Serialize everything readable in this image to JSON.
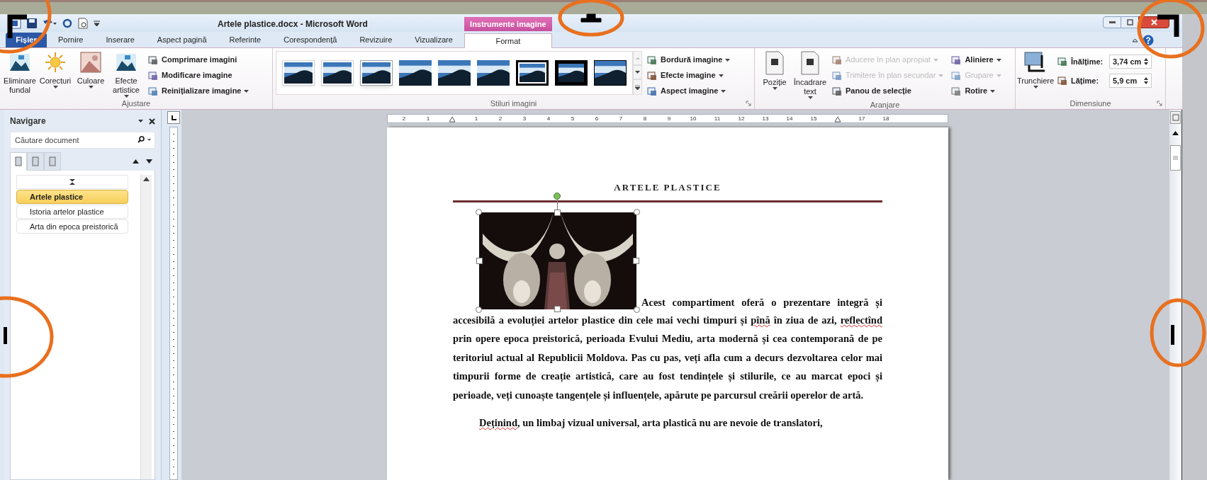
{
  "window": {
    "title": "Artele plastice.docx - Microsoft Word",
    "contextual_label": "Instrumente imagine"
  },
  "tabs": [
    {
      "label": "Fișier",
      "kind": "file",
      "selected": false
    },
    {
      "label": "Pornire",
      "kind": "tab",
      "selected": false
    },
    {
      "label": "Inserare",
      "kind": "tab",
      "selected": false
    },
    {
      "label": "Aspect pagină",
      "kind": "tab",
      "selected": false
    },
    {
      "label": "Referinte",
      "kind": "tab",
      "selected": false
    },
    {
      "label": "Corespondență",
      "kind": "tab",
      "selected": false
    },
    {
      "label": "Revizuire",
      "kind": "tab",
      "selected": false
    },
    {
      "label": "Vizualizare",
      "kind": "tab",
      "selected": false
    },
    {
      "label": "Format",
      "kind": "contextual",
      "selected": true
    }
  ],
  "ribbon_groups": [
    {
      "label": "Ajustare",
      "launcher": false,
      "items": [
        {
          "kind": "large",
          "label": "Eliminare fundal",
          "dropdown": false
        },
        {
          "kind": "large",
          "label": "Corecturi",
          "dropdown": true
        },
        {
          "kind": "large",
          "label": "Culoare",
          "dropdown": true
        },
        {
          "kind": "large",
          "label": "Efecte artistice",
          "dropdown": true
        },
        {
          "kind": "small",
          "label": "Comprimare imagini",
          "dropdown": false,
          "disabled": false
        },
        {
          "kind": "small",
          "label": "Modificare imagine",
          "dropdown": false,
          "disabled": false
        },
        {
          "kind": "small",
          "label": "Reinițializare imagine",
          "dropdown": true,
          "disabled": false
        }
      ]
    },
    {
      "label": "Stiluri imagini",
      "launcher": true,
      "items": [
        {
          "kind": "gallery",
          "styles": [
            {
              "kind": "soft"
            },
            {
              "kind": "soft"
            },
            {
              "kind": "shadow"
            },
            {
              "kind": "plain"
            },
            {
              "kind": "plain"
            },
            {
              "kind": "plain"
            },
            {
              "kind": "thick"
            },
            {
              "kind": "black"
            },
            {
              "kind": "thin"
            }
          ]
        },
        {
          "kind": "small",
          "label": "Bordură imagine",
          "dropdown": true,
          "disabled": false
        },
        {
          "kind": "small",
          "label": "Efecte imagine",
          "dropdown": true,
          "disabled": false
        },
        {
          "kind": "small",
          "label": "Aspect imagine",
          "dropdown": true,
          "disabled": false
        }
      ]
    },
    {
      "label": "Aranjare",
      "launcher": false,
      "items": [
        {
          "kind": "large",
          "label": "Poziție",
          "dropdown": true
        },
        {
          "kind": "large",
          "label": "Încadrare text",
          "dropdown": true
        },
        {
          "kind": "small",
          "label": "Aducere în plan apropiat",
          "dropdown": true,
          "disabled": true
        },
        {
          "kind": "small",
          "label": "Trimitere în plan secundar",
          "dropdown": true,
          "disabled": true
        },
        {
          "kind": "small",
          "label": "Panou de selecție",
          "dropdown": false,
          "disabled": false
        },
        {
          "kind": "small",
          "label": "Aliniere",
          "dropdown": true,
          "disabled": false
        },
        {
          "kind": "small",
          "label": "Grupare",
          "dropdown": true,
          "disabled": true
        },
        {
          "kind": "small",
          "label": "Rotire",
          "dropdown": true,
          "disabled": false
        }
      ]
    },
    {
      "label": "Dimensiune",
      "launcher": true,
      "items": [
        {
          "kind": "large",
          "label": "Trunchiere",
          "dropdown": true
        },
        {
          "kind": "spin",
          "label": "Înălțime:",
          "value": "3,74 cm"
        },
        {
          "kind": "spin",
          "label": "Lățime:",
          "value": "5,9 cm"
        }
      ]
    }
  ],
  "navigation": {
    "title": "Navigare",
    "search": {
      "placeholder": "Căutare document"
    },
    "view_tabs": [
      {
        "selected": true
      },
      {
        "selected": false
      },
      {
        "selected": false
      }
    ],
    "headings": [
      {
        "label": "Artele plastice",
        "selected": true
      },
      {
        "label": "Istoria artelor plastice",
        "selected": false
      },
      {
        "label": "Arta din epoca preistorică",
        "selected": false
      }
    ]
  },
  "ruler": {
    "marks": [
      {
        "kind": "number",
        "label": "2"
      },
      {
        "kind": "number",
        "label": "1"
      },
      {
        "kind": "indent"
      },
      {
        "kind": "number",
        "label": "1"
      },
      {
        "kind": "number",
        "label": "2"
      },
      {
        "kind": "number",
        "label": "3"
      },
      {
        "kind": "number",
        "label": "4"
      },
      {
        "kind": "number",
        "label": "5"
      },
      {
        "kind": "number",
        "label": "6"
      },
      {
        "kind": "number",
        "label": "7"
      },
      {
        "kind": "number",
        "label": "8"
      },
      {
        "kind": "number",
        "label": "9"
      },
      {
        "kind": "number",
        "label": "10"
      },
      {
        "kind": "number",
        "label": "11"
      },
      {
        "kind": "number",
        "label": "12"
      },
      {
        "kind": "number",
        "label": "13"
      },
      {
        "kind": "number",
        "label": "14"
      },
      {
        "kind": "number",
        "label": "15"
      },
      {
        "kind": "indent"
      },
      {
        "kind": "number",
        "label": "17"
      },
      {
        "kind": "number",
        "label": "18"
      }
    ]
  },
  "document": {
    "heading": "ARTELE PLASTICE",
    "image": {
      "kind": "picture",
      "selected": true
    },
    "paragraphs": [
      {
        "lead": "Acest compartiment oferă o prezentare integră și",
        "segments": [
          {
            "text": "accesibilă a evoluției artelor plastice din cele mai vechi timpuri și ",
            "misspelled": false
          },
          {
            "text": "pînă",
            "misspelled": true
          },
          {
            "text": " în ziua de azi, ",
            "misspelled": false
          },
          {
            "text": "reflectînd",
            "misspelled": true
          },
          {
            "text": " prin opere epoca preistorică, perioada Evului Mediu, arta modernă și cea contemporană de pe teritoriul actual al Republicii Moldova. Pas cu pas, veți afla cum a decurs dezvoltarea celor mai timpurii forme de creație artistică, care au fost tendințele și stilurile, ce au marcat epoci și perioade, veți cunoaște tangențele și influențele, apărute  pe parcursul creării operelor de artă.",
            "misspelled": false
          }
        ]
      },
      {
        "segments": [
          {
            "text": "Deținind",
            "misspelled": true
          },
          {
            "text": ", un limbaj vizual universal, arta plastică nu are nevoie de translatori,",
            "misspelled": false
          }
        ]
      }
    ]
  }
}
